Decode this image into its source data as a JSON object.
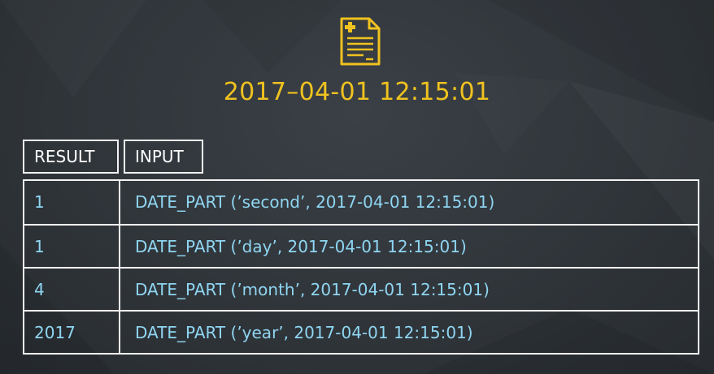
{
  "header": {
    "icon": "document-icon",
    "timestamp": "2017–04-01 12:15:01"
  },
  "table": {
    "columns": [
      "RESULT",
      "INPUT"
    ],
    "rows": [
      {
        "result": "1",
        "input": "DATE_PART (’second’, 2017-04-01 12:15:01)"
      },
      {
        "result": "1",
        "input": "DATE_PART (’day’, 2017-04-01 12:15:01)"
      },
      {
        "result": "4",
        "input": "DATE_PART (’month’, 2017-04-01 12:15:01)"
      },
      {
        "result": "2017",
        "input": "DATE_PART (’year’, 2017-04-01 12:15:01)"
      }
    ]
  },
  "colors": {
    "accent": "#f0c21f",
    "value_text": "#8fd6f2",
    "border": "#f2f2f2",
    "background": "#30353a"
  }
}
